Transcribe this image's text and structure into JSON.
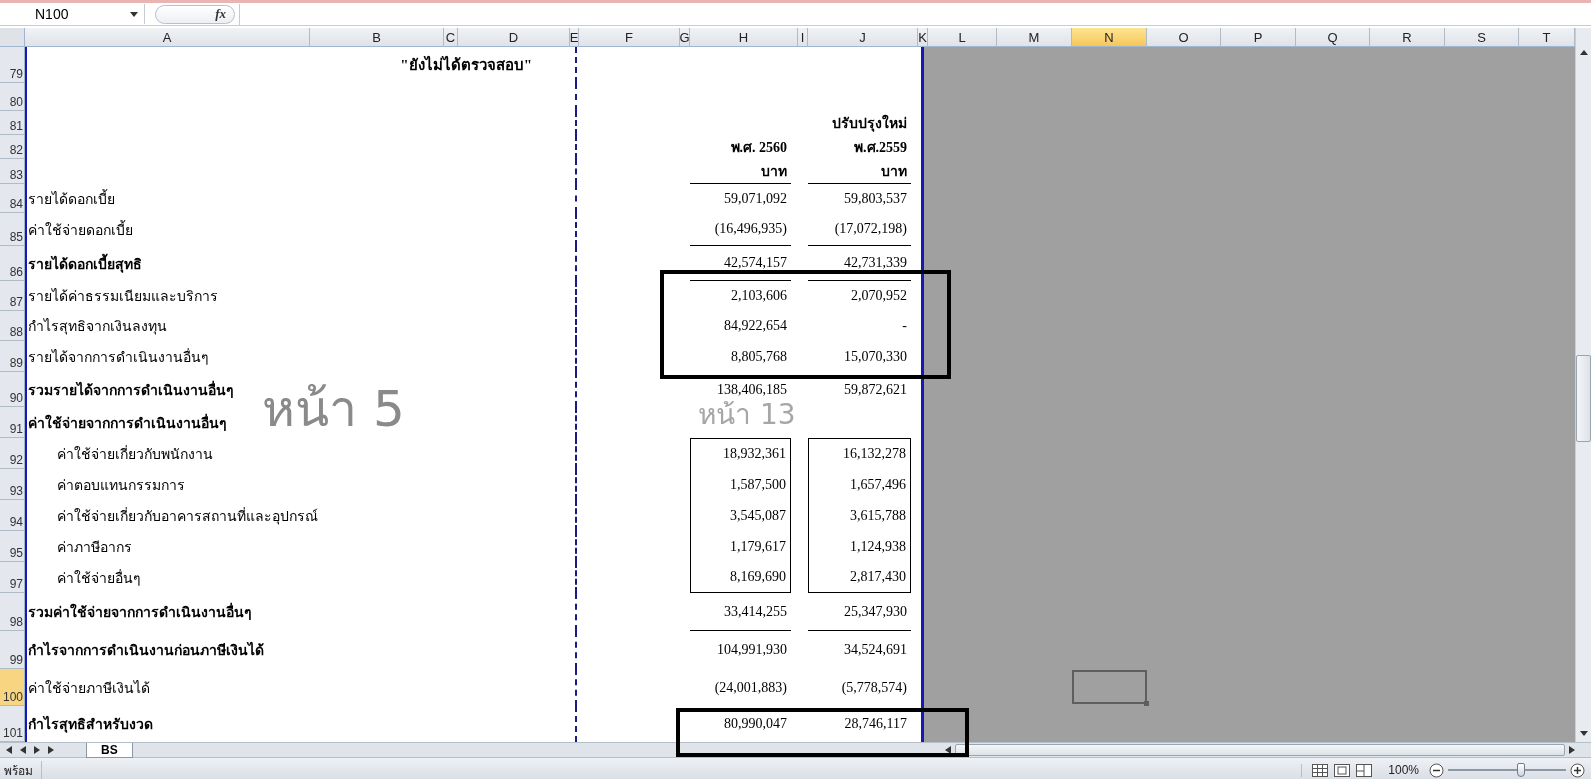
{
  "formula_bar": {
    "name_box": "N100",
    "function_button": "fx"
  },
  "columns": [
    {
      "label": "A",
      "selected": false
    },
    {
      "label": "B",
      "selected": false
    },
    {
      "label": "C",
      "selected": false
    },
    {
      "label": "D",
      "selected": false
    },
    {
      "label": "E",
      "selected": false
    },
    {
      "label": "F",
      "selected": false
    },
    {
      "label": "G",
      "selected": false
    },
    {
      "label": "H",
      "selected": false
    },
    {
      "label": "I",
      "selected": false
    },
    {
      "label": "J",
      "selected": false
    },
    {
      "label": "K",
      "selected": false
    },
    {
      "label": "L",
      "selected": false
    },
    {
      "label": "M",
      "selected": false
    },
    {
      "label": "N",
      "selected": true
    },
    {
      "label": "O",
      "selected": false
    },
    {
      "label": "P",
      "selected": false
    },
    {
      "label": "Q",
      "selected": false
    },
    {
      "label": "R",
      "selected": false
    },
    {
      "label": "S",
      "selected": false
    },
    {
      "label": "T",
      "selected": false
    }
  ],
  "rows": [
    {
      "number": "79",
      "selected": false,
      "kind": "note",
      "label": "\"ยังไม่ได้ตรวจสอบ\""
    },
    {
      "number": "80",
      "selected": false,
      "kind": "blank"
    },
    {
      "number": "81",
      "selected": false,
      "kind": "header",
      "j": "ปรับปรุงใหม่"
    },
    {
      "number": "82",
      "selected": false,
      "kind": "header",
      "h": "พ.ศ. 2560",
      "j": "พ.ศ.2559"
    },
    {
      "number": "83",
      "selected": false,
      "kind": "header",
      "h": "บาท",
      "j": "บาท",
      "underline": true
    },
    {
      "number": "84",
      "selected": false,
      "kind": "item",
      "label": "รายได้ดอกเบี้ย",
      "h": "59,071,092",
      "j": "59,803,537"
    },
    {
      "number": "85",
      "selected": false,
      "kind": "item",
      "label": "ค่าใช้จ่ายดอกเบี้ย",
      "h": "(16,496,935)",
      "j": "(17,072,198)",
      "underline": true
    },
    {
      "number": "86",
      "selected": false,
      "kind": "heading",
      "label": "รายได้ดอกเบี้ยสุทธิ",
      "h": "42,574,157",
      "j": "42,731,339",
      "underline": true
    },
    {
      "number": "87",
      "selected": false,
      "kind": "item",
      "label": "รายได้ค่าธรรมเนียมและบริการ",
      "h": "2,103,606",
      "j": "2,070,952"
    },
    {
      "number": "88",
      "selected": false,
      "kind": "item",
      "label": "กำไรสุทธิจากเงินลงทุน",
      "h": "84,922,654",
      "j": "-"
    },
    {
      "number": "89",
      "selected": false,
      "kind": "item",
      "label": "รายได้จากการดำเนินงานอื่นๆ",
      "h": "8,805,768",
      "j": "15,070,330"
    },
    {
      "number": "90",
      "selected": false,
      "kind": "heading",
      "label": "รวมรายได้จากการดำเนินงานอื่นๆ",
      "h": "138,406,185",
      "j": "59,872,621"
    },
    {
      "number": "91",
      "selected": false,
      "kind": "heading",
      "label": "ค่าใช้จ่ายจากการดำเนินงานอื่นๆ"
    },
    {
      "number": "92",
      "selected": false,
      "kind": "subitem",
      "label": "ค่าใช้จ่ายเกี่ยวกับพนักงาน",
      "h": "18,932,361",
      "j": "16,132,278",
      "boxed": true
    },
    {
      "number": "93",
      "selected": false,
      "kind": "subitem",
      "label": "ค่าตอบแทนกรรมการ",
      "h": "1,587,500",
      "j": "1,657,496",
      "boxed": true
    },
    {
      "number": "94",
      "selected": false,
      "kind": "subitem",
      "label": "ค่าใช้จ่ายเกี่ยวกับอาคารสถานที่และอุปกรณ์",
      "h": "3,545,087",
      "j": "3,615,788",
      "boxed": true
    },
    {
      "number": "95",
      "selected": false,
      "kind": "subitem",
      "label": "ค่าภาษีอากร",
      "h": "1,179,617",
      "j": "1,124,938",
      "boxed": true
    },
    {
      "number": "97",
      "selected": false,
      "kind": "subitem",
      "label": "ค่าใช้จ่ายอื่นๆ",
      "h": "8,169,690",
      "j": "2,817,430",
      "boxed": true
    },
    {
      "number": "98",
      "selected": false,
      "kind": "heading",
      "label": "รวมค่าใช้จ่ายจากการดำเนินงานอื่นๆ",
      "h": "33,414,255",
      "j": "25,347,930",
      "underline": true
    },
    {
      "number": "99",
      "selected": false,
      "kind": "heading",
      "label": "กำไรจากการดำเนินงานก่อนภาษีเงินได้",
      "h": "104,991,930",
      "j": "34,524,691"
    },
    {
      "number": "100",
      "selected": true,
      "kind": "item",
      "label": "ค่าใช้จ่ายภาษีเงินได้",
      "h": "(24,001,883)",
      "j": "(5,778,574)"
    },
    {
      "number": "101",
      "selected": false,
      "kind": "heading",
      "label": "กำไรสุทธิสำหรับงวด",
      "h": "80,990,047",
      "j": "28,746,117"
    }
  ],
  "page_marks": [
    {
      "text": "หน้า 5",
      "kind": "large"
    },
    {
      "text": "หน้า 13",
      "kind": "small"
    }
  ],
  "sheet_tabs": [
    {
      "label": "BS",
      "selected": true
    }
  ],
  "status_bar": {
    "mode": "พร้อม",
    "zoom": "100%",
    "level": 0.62
  }
}
